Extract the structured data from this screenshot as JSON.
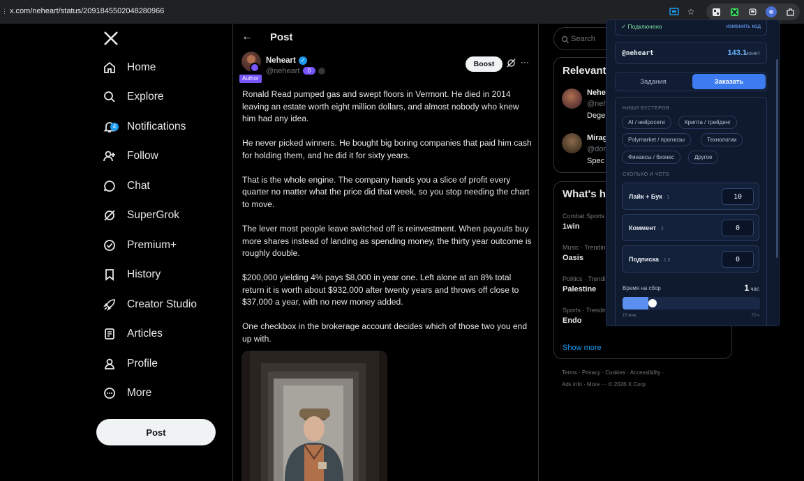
{
  "browser": {
    "url": "x.com/neheart/status/2091845502048280966"
  },
  "nav": {
    "items": [
      {
        "label": "Home",
        "icon": "home-icon"
      },
      {
        "label": "Explore",
        "icon": "search-icon"
      },
      {
        "label": "Notifications",
        "icon": "bell-icon",
        "badge": "4"
      },
      {
        "label": "Follow",
        "icon": "add-person-icon"
      },
      {
        "label": "Chat",
        "icon": "chat-icon"
      },
      {
        "label": "SuperGrok",
        "icon": "grok-icon"
      },
      {
        "label": "Premium+",
        "icon": "verified-icon"
      },
      {
        "label": "History",
        "icon": "bookmark-icon"
      },
      {
        "label": "Creator Studio",
        "icon": "rocket-icon"
      },
      {
        "label": "Articles",
        "icon": "article-icon"
      },
      {
        "label": "Profile",
        "icon": "person-icon"
      },
      {
        "label": "More",
        "icon": "more-circle-icon"
      }
    ],
    "post_label": "Post"
  },
  "main": {
    "header_title": "Post",
    "author": {
      "name": "Neheart",
      "handle": "@neheart",
      "author_tag": "Author",
      "badge": "0"
    },
    "boost_label": "Boost",
    "paragraphs": [
      "Ronald Read pumped gas and swept floors in Vermont. He died in 2014 leaving an estate worth eight million dollars, and almost nobody who knew him had any idea.",
      "He never picked winners. He bought big boring companies that paid him cash for holding them, and he did it for sixty years.",
      "That is the whole engine. The company hands you a slice of profit every quarter no matter what the price did that week, so you stop needing the chart to move.",
      "The lever most people leave switched off is reinvestment. When payouts buy more shares instead of landing as spending money, the thirty year outcome is roughly double.",
      "$200,000 yielding 4% pays $8,000 in year one. Left alone at an 8% total return it is worth about $932,000 after twenty years and throws off close to $37,000 a year, with no new money added.",
      "One checkbox in the brokerage account decides which of those two you end up with."
    ]
  },
  "right": {
    "search_placeholder": "Search",
    "relevant_title": "Relevant people",
    "relevant": [
      {
        "name": "Neheart",
        "handle": "@neheart",
        "bio": "Degen"
      },
      {
        "name": "Mirage",
        "handle": "@don",
        "bio": "Spec"
      }
    ],
    "trends_title": "What's happening",
    "trends": [
      {
        "category": "Combat Sports · Trending",
        "name": "1win"
      },
      {
        "category": "Music · Trending",
        "name": "Oasis"
      },
      {
        "category": "Politics · Trending",
        "name": "Palestine"
      },
      {
        "category": "Sports · Trending",
        "name": "Endo"
      }
    ],
    "show_more": "Show more",
    "footer_line1": "Terms  ·  Privacy  ·  Cookies  ·  Accessibility  ·",
    "footer_line2": "Ads info  ·  More ···   © 2026 X Corp."
  },
  "extension": {
    "connected": "✓ Подключено",
    "change_code": "изменить код",
    "account": "@neheart",
    "balance": "143.1",
    "balance_unit": "монет",
    "tab_tasks": "Задания",
    "tab_order": "Заказать",
    "niches_title": "НИШИ БУСТЕРОВ",
    "niches": [
      "AI / нейросети",
      "Крипта / трейдинг",
      "Polymarket / прогнозы",
      "Технологии",
      "Финансы / бизнес",
      "Другое"
    ],
    "amount_title": "СКОЛЬКО И ЧЕГО",
    "services": [
      {
        "label": "Лайк + Бук",
        "rate": "· 1",
        "value": "10"
      },
      {
        "label": "Коммент",
        "rate": "· 2",
        "value": "0"
      },
      {
        "label": "Подписка",
        "rate": "· 1.5",
        "value": "0"
      }
    ],
    "time_label": "Время на сбор",
    "time_value": "1",
    "time_unit": "час",
    "slider_min": "15 мин",
    "slider_max": "72 ч",
    "slider_fraction": 0.22
  },
  "colors": {
    "accent": "#1d9bf0",
    "ext_accent": "#3d7cf0",
    "badge_purple": "#7856ff"
  }
}
